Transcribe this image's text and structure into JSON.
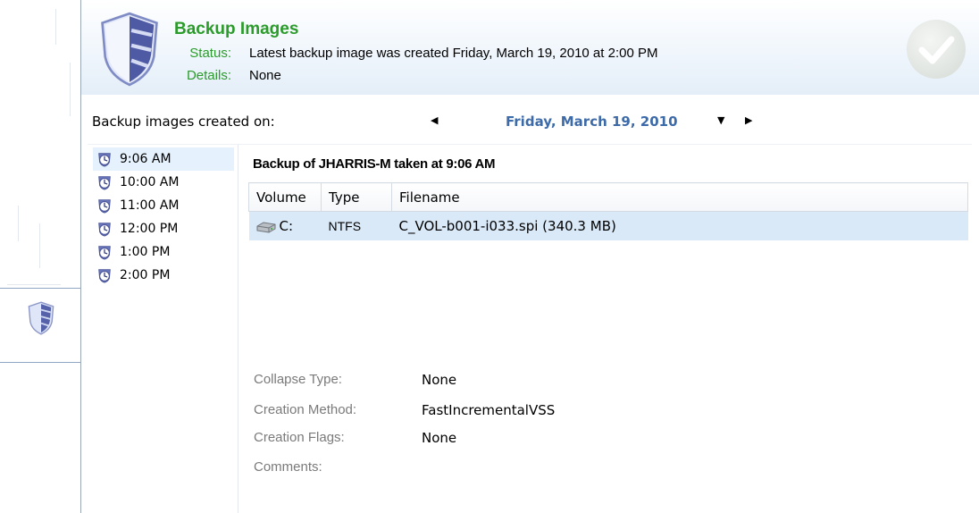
{
  "header": {
    "title": "Backup Images",
    "status_label": "Status:",
    "status_value": "Latest backup image was created Friday, March 19, 2010 at 2:00 PM",
    "details_label": "Details:",
    "details_value": "None"
  },
  "date_nav": {
    "label": "Backup images created on:",
    "selected_date": "Friday, March 19, 2010"
  },
  "time_list": [
    {
      "time": "9:06 AM",
      "selected": true
    },
    {
      "time": "10:00 AM",
      "selected": false
    },
    {
      "time": "11:00 AM",
      "selected": false
    },
    {
      "time": "12:00 PM",
      "selected": false
    },
    {
      "time": "1:00 PM",
      "selected": false
    },
    {
      "time": "2:00 PM",
      "selected": false
    }
  ],
  "detail": {
    "title": "Backup of JHARRIS-M taken at 9:06 AM",
    "columns": {
      "volume": "Volume",
      "type": "Type",
      "filename": "Filename"
    },
    "rows": [
      {
        "volume": "C:",
        "type": "NTFS",
        "filename": "C_VOL-b001-i033.spi (340.3 MB)"
      }
    ],
    "properties": [
      {
        "label": "Collapse Type:",
        "value": "None"
      },
      {
        "label": "Creation Method:",
        "value": "FastIncrementalVSS"
      },
      {
        "label": "Creation Flags:",
        "value": "None"
      },
      {
        "label": "Comments:",
        "value": ""
      }
    ]
  },
  "icons": {
    "header": "shield-icon",
    "status": "check-icon",
    "time_item": "clock-icon",
    "drive": "drive-icon",
    "nav": "shield-icon"
  },
  "colors": {
    "title_green": "#2b9b2b",
    "date_blue": "#3d6aa8",
    "selection": "#dae9f7",
    "status_check": "#d9ddd9"
  }
}
